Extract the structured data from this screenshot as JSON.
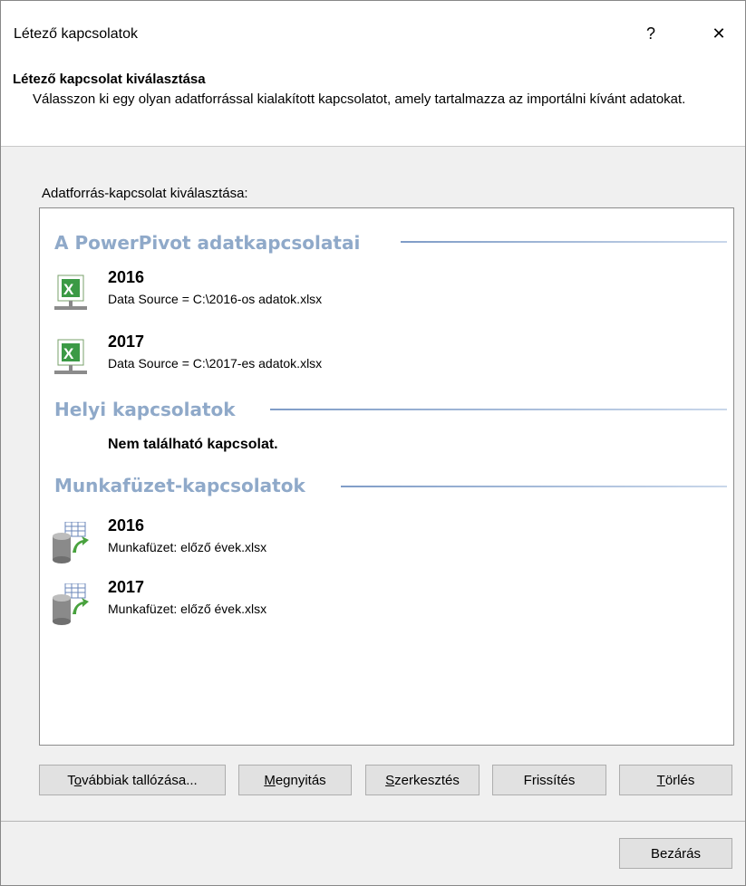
{
  "window": {
    "title": "Létező kapcsolatok",
    "help_label": "?",
    "close_label": "✕"
  },
  "header": {
    "title": "Létező kapcsolat kiválasztása",
    "description": "Válasszon ki egy olyan adatforrással kialakított kapcsolatot, amely tartalmazza az importálni kívánt adatokat."
  },
  "list_label": "Adatforrás-kapcsolat kiválasztása:",
  "groups": [
    {
      "title": "A PowerPivot adatkapcsolatai",
      "items": [
        {
          "name": "2016",
          "detail": "Data Source = C:\\2016-os adatok.xlsx",
          "icon": "excel-connection-icon"
        },
        {
          "name": "2017",
          "detail": "Data Source = C:\\2017-es adatok.xlsx",
          "icon": "excel-connection-icon"
        }
      ]
    },
    {
      "title": "Helyi kapcsolatok",
      "empty_text": "Nem található kapcsolat."
    },
    {
      "title": "Munkafüzet-kapcsolatok",
      "items": [
        {
          "name": "2016",
          "detail": "Munkafüzet: előző évek.xlsx",
          "icon": "database-table-icon"
        },
        {
          "name": "2017",
          "detail": "Munkafüzet: előző évek.xlsx",
          "icon": "database-table-icon"
        }
      ]
    }
  ],
  "buttons": {
    "browse": {
      "pre": "T",
      "key": "o",
      "post": "vábbiak tallózása..."
    },
    "open": {
      "pre": "",
      "key": "M",
      "post": "egnyitás"
    },
    "edit": {
      "pre": "",
      "key": "S",
      "post": "zerkesztés"
    },
    "refresh": {
      "pre": "Frissítés",
      "key": "",
      "post": ""
    },
    "delete": {
      "pre": "",
      "key": "T",
      "post": "örlés"
    },
    "close": {
      "pre": "Bezárás",
      "key": "",
      "post": ""
    }
  }
}
